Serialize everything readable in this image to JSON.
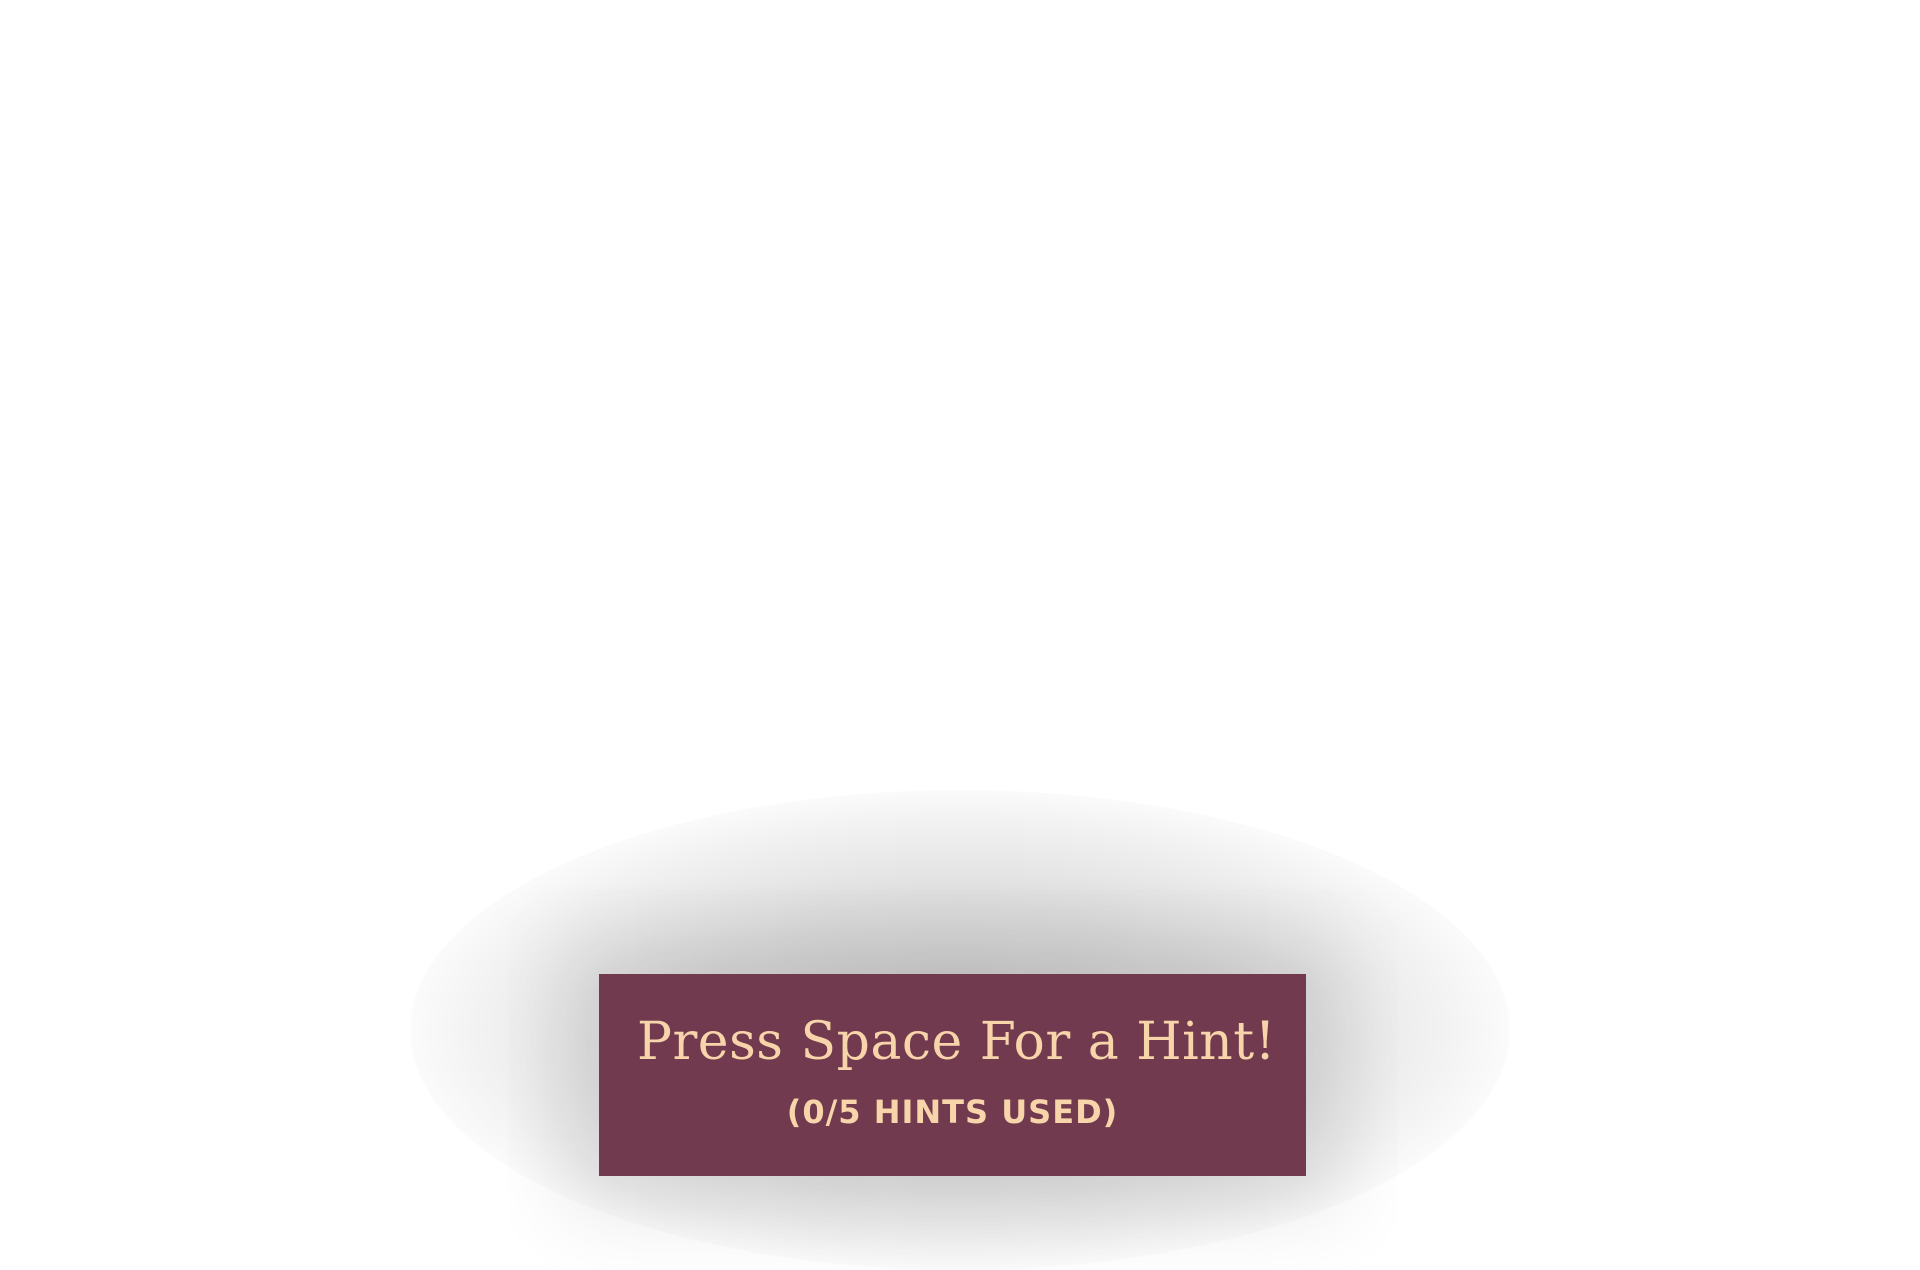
{
  "colors": {
    "background": "#ffffff",
    "hint_box": "#713a4e",
    "hint_text": "#f8d4ab"
  },
  "hint_panel": {
    "title": "Press Space For a Hint!",
    "counter": "(0/5 HINTS USED)",
    "hints_used": 0,
    "hints_total": 5
  }
}
